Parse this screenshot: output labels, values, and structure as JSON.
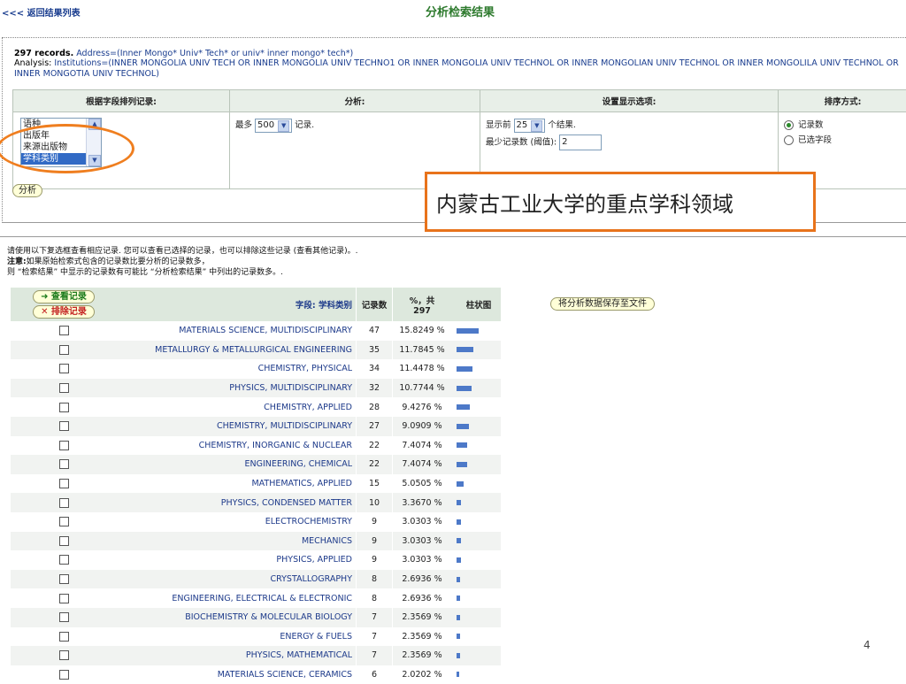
{
  "header": {
    "back_link": "<<< 返回结果列表",
    "title": "分析检索结果"
  },
  "summary": {
    "records": "297 records.",
    "address": "Address=(Inner Mongo* Univ* Tech* or univ* inner mongo* tech*)",
    "analysis_label": "Analysis:",
    "analysis_text": "Institutions=(INNER MONGOLIA UNIV TECH OR INNER MONGOLIA UNIV TECHNO1 OR INNER MONGOLIA UNIV TECHNOL OR INNER MONGOLIAN UNIV TECHNOL OR INNER MONGOLILA UNIV TECHNOL OR INNER MONGOTIA UNIV TECHNOL)"
  },
  "settings": {
    "headers": [
      "根据字段排列记录:",
      "分析:",
      "设置显示选项:",
      "排序方式:"
    ],
    "field_list": [
      "语种",
      "出版年",
      "来源出版物",
      "学科类别"
    ],
    "max_prefix": "最多",
    "max_value": "500",
    "max_suffix": "记录.",
    "show_prefix": "显示前",
    "show_value": "25",
    "show_suffix": "个结果.",
    "min_label": "最少记录数 (阈值):",
    "min_value": "2",
    "sort_options": [
      "记录数",
      "已选字段"
    ]
  },
  "analyze_button": "分析",
  "callout_text": "内蒙古工业大学的重点学科领域",
  "instructions": {
    "line1": "请使用以下复选框查看相应记录. 您可以查看已选择的记录，也可以排除这些记录 (查看其他记录)。.",
    "note_label": "注意:",
    "line2": "如果原始检索式包含的记录数比要分析的记录数多，",
    "line3": "则 “检索结果” 中显示的记录数有可能比 “分析检索结果” 中列出的记录数多。."
  },
  "table": {
    "view_button": "➜ 查看记录",
    "exclude_button": "✕ 排除记录",
    "field_header": "字段: 学科类别",
    "count_header": "记录数",
    "percent_header_1": "%，共",
    "percent_header_2": "297",
    "bar_header": "柱状图",
    "save_button": "将分析数据保存至文件",
    "rows": [
      {
        "field": "MATERIALS SCIENCE, MULTIDISCIPLINARY",
        "count": "47",
        "pct": "15.8249 %",
        "share": 15.8249
      },
      {
        "field": "METALLURGY & METALLURGICAL ENGINEERING",
        "count": "35",
        "pct": "11.7845 %",
        "share": 11.7845
      },
      {
        "field": "CHEMISTRY, PHYSICAL",
        "count": "34",
        "pct": "11.4478 %",
        "share": 11.4478
      },
      {
        "field": "PHYSICS, MULTIDISCIPLINARY",
        "count": "32",
        "pct": "10.7744 %",
        "share": 10.7744
      },
      {
        "field": "CHEMISTRY, APPLIED",
        "count": "28",
        "pct": "9.4276 %",
        "share": 9.4276
      },
      {
        "field": "CHEMISTRY, MULTIDISCIPLINARY",
        "count": "27",
        "pct": "9.0909 %",
        "share": 9.0909
      },
      {
        "field": "CHEMISTRY, INORGANIC & NUCLEAR",
        "count": "22",
        "pct": "7.4074 %",
        "share": 7.4074
      },
      {
        "field": "ENGINEERING, CHEMICAL",
        "count": "22",
        "pct": "7.4074 %",
        "share": 7.4074
      },
      {
        "field": "MATHEMATICS, APPLIED",
        "count": "15",
        "pct": "5.0505 %",
        "share": 5.0505
      },
      {
        "field": "PHYSICS, CONDENSED MATTER",
        "count": "10",
        "pct": "3.3670 %",
        "share": 3.367
      },
      {
        "field": "ELECTROCHEMISTRY",
        "count": "9",
        "pct": "3.0303 %",
        "share": 3.0303
      },
      {
        "field": "MECHANICS",
        "count": "9",
        "pct": "3.0303 %",
        "share": 3.0303
      },
      {
        "field": "PHYSICS, APPLIED",
        "count": "9",
        "pct": "3.0303 %",
        "share": 3.0303
      },
      {
        "field": "CRYSTALLOGRAPHY",
        "count": "8",
        "pct": "2.6936 %",
        "share": 2.6936
      },
      {
        "field": "ENGINEERING, ELECTRICAL & ELECTRONIC",
        "count": "8",
        "pct": "2.6936 %",
        "share": 2.6936
      },
      {
        "field": "BIOCHEMISTRY & MOLECULAR BIOLOGY",
        "count": "7",
        "pct": "2.3569 %",
        "share": 2.3569
      },
      {
        "field": "ENERGY & FUELS",
        "count": "7",
        "pct": "2.3569 %",
        "share": 2.3569
      },
      {
        "field": "PHYSICS, MATHEMATICAL",
        "count": "7",
        "pct": "2.3569 %",
        "share": 2.3569
      },
      {
        "field": "MATERIALS SCIENCE, CERAMICS",
        "count": "6",
        "pct": "2.0202 %",
        "share": 2.0202
      }
    ]
  },
  "page_number": "4",
  "colors": {
    "accent": "#e8731b",
    "bar": "#4d79c8",
    "title": "#2d7a2d"
  }
}
